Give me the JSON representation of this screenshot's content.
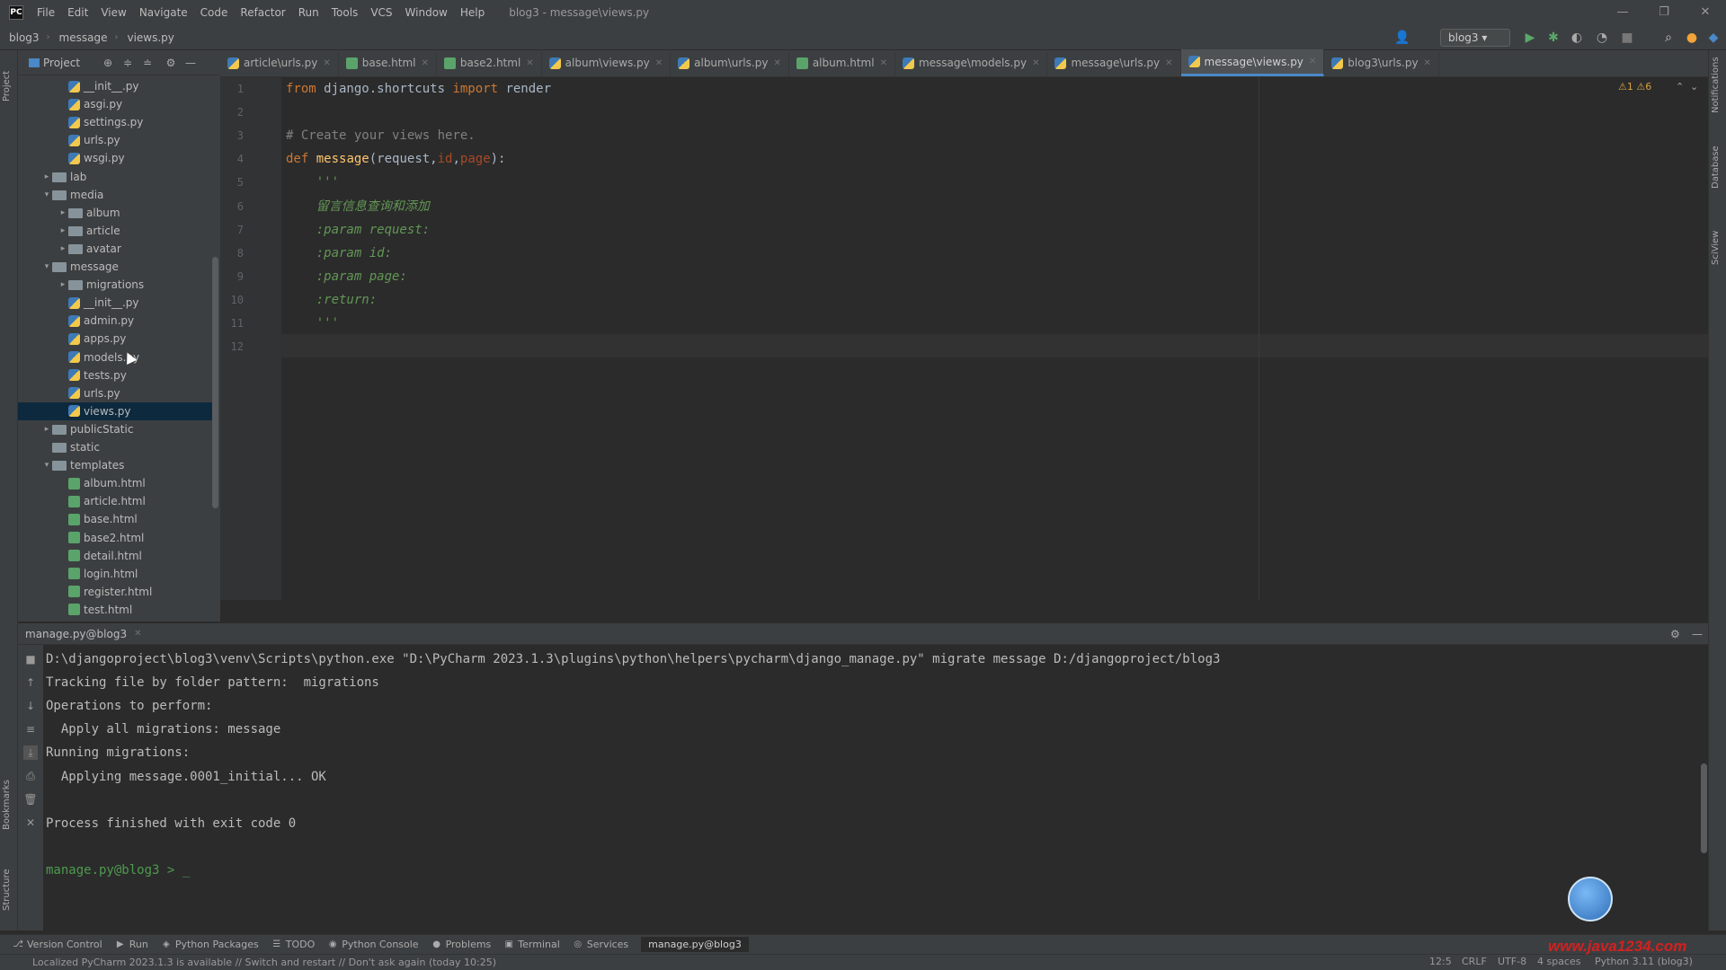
{
  "menubar": {
    "items": [
      "File",
      "Edit",
      "View",
      "Navigate",
      "Code",
      "Refactor",
      "Run",
      "Tools",
      "VCS",
      "Window",
      "Help"
    ],
    "title": "blog3 - message\\views.py",
    "minimize": "—",
    "maximize": "❐",
    "close": "✕"
  },
  "navbar": {
    "crumbs": [
      "blog3",
      "message",
      "views.py"
    ],
    "run_config": "blog3"
  },
  "project": {
    "title": "Project",
    "tree": [
      {
        "label": "__init__.py",
        "type": "py",
        "indent": 2
      },
      {
        "label": "asgi.py",
        "type": "py",
        "indent": 2
      },
      {
        "label": "settings.py",
        "type": "py",
        "indent": 2
      },
      {
        "label": "urls.py",
        "type": "py",
        "indent": 2
      },
      {
        "label": "wsgi.py",
        "type": "py",
        "indent": 2
      },
      {
        "label": "lab",
        "type": "folder",
        "indent": 1,
        "arrow": "▸"
      },
      {
        "label": "media",
        "type": "folder",
        "indent": 1,
        "arrow": "▾"
      },
      {
        "label": "album",
        "type": "folder",
        "indent": 2,
        "arrow": "▸"
      },
      {
        "label": "article",
        "type": "folder",
        "indent": 2,
        "arrow": "▸"
      },
      {
        "label": "avatar",
        "type": "folder",
        "indent": 2,
        "arrow": "▸"
      },
      {
        "label": "message",
        "type": "folder",
        "indent": 1,
        "arrow": "▾"
      },
      {
        "label": "migrations",
        "type": "folder",
        "indent": 2,
        "arrow": "▸"
      },
      {
        "label": "__init__.py",
        "type": "py",
        "indent": 2
      },
      {
        "label": "admin.py",
        "type": "py",
        "indent": 2
      },
      {
        "label": "apps.py",
        "type": "py",
        "indent": 2
      },
      {
        "label": "models.py",
        "type": "py",
        "indent": 2
      },
      {
        "label": "tests.py",
        "type": "py",
        "indent": 2
      },
      {
        "label": "urls.py",
        "type": "py",
        "indent": 2
      },
      {
        "label": "views.py",
        "type": "py",
        "indent": 2,
        "selected": true
      },
      {
        "label": "publicStatic",
        "type": "folder",
        "indent": 1,
        "arrow": "▸"
      },
      {
        "label": "static",
        "type": "folder",
        "indent": 1
      },
      {
        "label": "templates",
        "type": "folder",
        "indent": 1,
        "arrow": "▾"
      },
      {
        "label": "album.html",
        "type": "html",
        "indent": 2
      },
      {
        "label": "article.html",
        "type": "html",
        "indent": 2
      },
      {
        "label": "base.html",
        "type": "html",
        "indent": 2
      },
      {
        "label": "base2.html",
        "type": "html",
        "indent": 2
      },
      {
        "label": "detail.html",
        "type": "html",
        "indent": 2
      },
      {
        "label": "login.html",
        "type": "html",
        "indent": 2
      },
      {
        "label": "register.html",
        "type": "html",
        "indent": 2
      },
      {
        "label": "test.html",
        "type": "html",
        "indent": 2
      }
    ]
  },
  "tabs": [
    {
      "label": "article\\urls.py",
      "type": "py"
    },
    {
      "label": "base.html",
      "type": "html"
    },
    {
      "label": "base2.html",
      "type": "html"
    },
    {
      "label": "album\\views.py",
      "type": "py"
    },
    {
      "label": "album\\urls.py",
      "type": "py"
    },
    {
      "label": "album.html",
      "type": "html"
    },
    {
      "label": "message\\models.py",
      "type": "py"
    },
    {
      "label": "message\\urls.py",
      "type": "py"
    },
    {
      "label": "message\\views.py",
      "type": "py",
      "active": true
    },
    {
      "label": "blog3\\urls.py",
      "type": "py"
    }
  ],
  "editor": {
    "inspections": "⚠1 ⚠6",
    "lines": [
      {
        "n": "1",
        "parts": [
          [
            "kw",
            "from"
          ],
          [
            "plain",
            " django.shortcuts "
          ],
          [
            "kw",
            "import"
          ],
          [
            "plain",
            " render"
          ]
        ]
      },
      {
        "n": "2",
        "parts": []
      },
      {
        "n": "3",
        "parts": [
          [
            "cm",
            "# Create your views here."
          ]
        ]
      },
      {
        "n": "4",
        "parts": [
          [
            "kw",
            "def"
          ],
          [
            "plain",
            " "
          ],
          [
            "fn",
            "message"
          ],
          [
            "plain",
            "(request,"
          ],
          [
            "param",
            "id"
          ],
          [
            "plain",
            ","
          ],
          [
            "param",
            "page"
          ],
          [
            "plain",
            "):"
          ]
        ]
      },
      {
        "n": "5",
        "parts": [
          [
            "doc",
            "    '''"
          ]
        ]
      },
      {
        "n": "6",
        "parts": [
          [
            "doc",
            "    留言信息查询和添加"
          ]
        ]
      },
      {
        "n": "7",
        "parts": [
          [
            "doc",
            "    :param request:"
          ]
        ]
      },
      {
        "n": "8",
        "parts": [
          [
            "doc",
            "    :param id:"
          ]
        ]
      },
      {
        "n": "9",
        "parts": [
          [
            "doc",
            "    :param page:"
          ]
        ]
      },
      {
        "n": "10",
        "parts": [
          [
            "doc",
            "    :return:"
          ]
        ]
      },
      {
        "n": "11",
        "parts": [
          [
            "doc",
            "    '''"
          ]
        ]
      },
      {
        "n": "12",
        "parts": []
      }
    ]
  },
  "run": {
    "title": "manage.py@blog3",
    "lines": [
      "D:\\djangoproject\\blog3\\venv\\Scripts\\python.exe \"D:\\PyCharm 2023.1.3\\plugins\\python\\helpers\\pycharm\\django_manage.py\" migrate message D:/djangoproject/blog3",
      "Tracking file by folder pattern:  migrations",
      "Operations to perform:",
      "  Apply all migrations: message",
      "Running migrations:",
      "  Applying message.0001_initial... OK",
      "",
      "Process finished with exit code 0",
      "",
      "manage.py@blog3 > _"
    ]
  },
  "toolwindows": [
    {
      "label": "Version Control",
      "icon": "⎇"
    },
    {
      "label": "Run",
      "icon": "▶"
    },
    {
      "label": "Python Packages",
      "icon": "◈"
    },
    {
      "label": "TODO",
      "icon": "☰"
    },
    {
      "label": "Python Console",
      "icon": "◉"
    },
    {
      "label": "Problems",
      "icon": "●"
    },
    {
      "label": "Terminal",
      "icon": "▣"
    },
    {
      "label": "Services",
      "icon": "◎"
    },
    {
      "label": "manage.py@blog3",
      "icon": "",
      "active": true
    }
  ],
  "status": {
    "message": "Localized PyCharm 2023.1.3 is available // Switch and restart // Don't ask again (today 10:25)",
    "position": "12:5",
    "line_sep": "CRLF",
    "encoding": "UTF-8",
    "indent": "4 spaces",
    "interpreter": "Python 3.11 (blog3)"
  },
  "watermark": "www.java1234.com",
  "colors": {
    "accent": "#4a88c7",
    "selection": "#0d293e",
    "run_green": "#59a869"
  }
}
